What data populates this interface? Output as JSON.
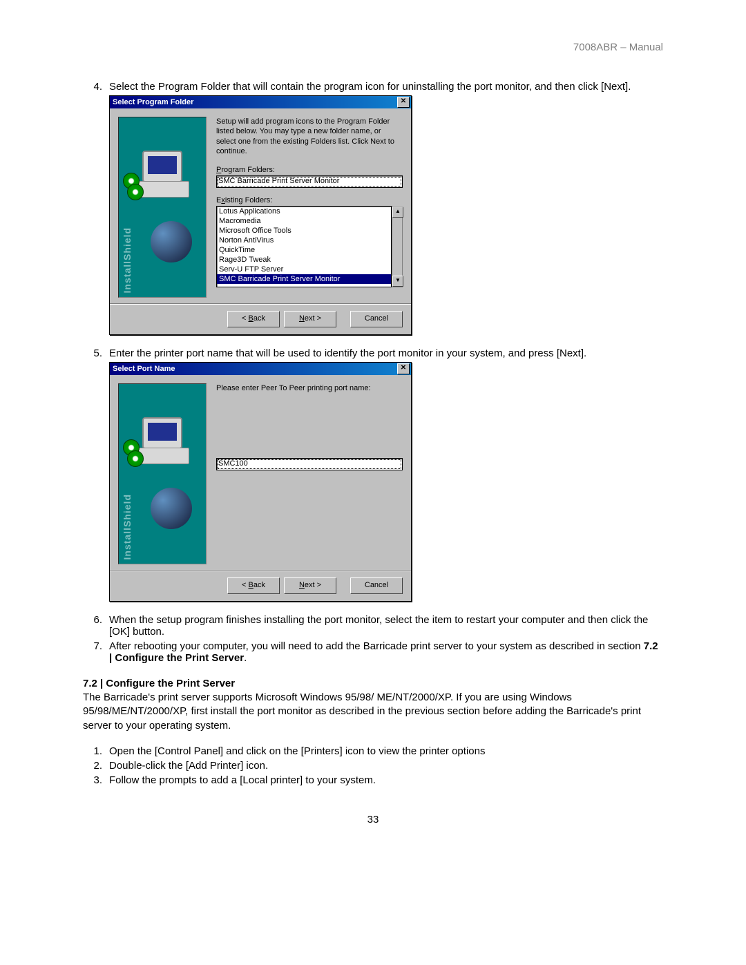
{
  "header": "7008ABR – Manual",
  "step4": {
    "num": "4.",
    "text": "Select the Program Folder that will contain the program icon for uninstalling the port monitor, and then click [Next]."
  },
  "dialog1": {
    "title": "Select Program Folder",
    "desc": "Setup will add program icons to the Program Folder listed below. You may type a new folder name, or select one from the existing Folders list.  Click Next to continue.",
    "label_pf": "Program Folders:",
    "value_pf": "SMC Barricade Print Server Monitor",
    "label_ef": "Existing Folders:",
    "folders": [
      "Lotus Applications",
      "Macromedia",
      "Microsoft Office Tools",
      "Norton AntiVirus",
      "QuickTime",
      "Rage3D Tweak",
      "Serv-U FTP Server",
      "SMC Barricade Print Server Monitor"
    ],
    "selected_index": 7
  },
  "step5": {
    "num": "5.",
    "text": "Enter the printer port name that will be used to identify the port monitor in your system, and press [Next]."
  },
  "dialog2": {
    "title": "Select Port Name",
    "desc": "Please enter Peer To Peer printing port name:",
    "value": "SMC100"
  },
  "buttons": {
    "back": "< Back",
    "next": "Next >",
    "cancel": "Cancel"
  },
  "step6": {
    "num": "6.",
    "text": "When the setup program finishes installing the port monitor, select the item to restart your computer and then click the [OK] button."
  },
  "step7": {
    "num": "7.",
    "text_a": "After rebooting your computer, you will need to add the Barricade print server to your system as described in section ",
    "text_b": "7.2 | Configure the Print Server",
    "text_c": "."
  },
  "section72": {
    "title": "7.2 | Configure the Print Server",
    "para": "The Barricade's print server supports Microsoft Windows 95/98/ ME/NT/2000/XP. If you are using Windows 95/98/ME/NT/2000/XP, first install the port monitor as described in the previous section before adding the Barricade's print server to your operating system."
  },
  "sub1": {
    "num": "1.",
    "text": "Open the [Control Panel] and click on the [Printers] icon to view the printer options"
  },
  "sub2": {
    "num": "2.",
    "text": "Double-click the [Add Printer] icon."
  },
  "sub3": {
    "num": "3.",
    "text": "Follow the prompts to add a [Local printer] to your system."
  },
  "page_num": "33",
  "sidebar_text": "InstallShield"
}
